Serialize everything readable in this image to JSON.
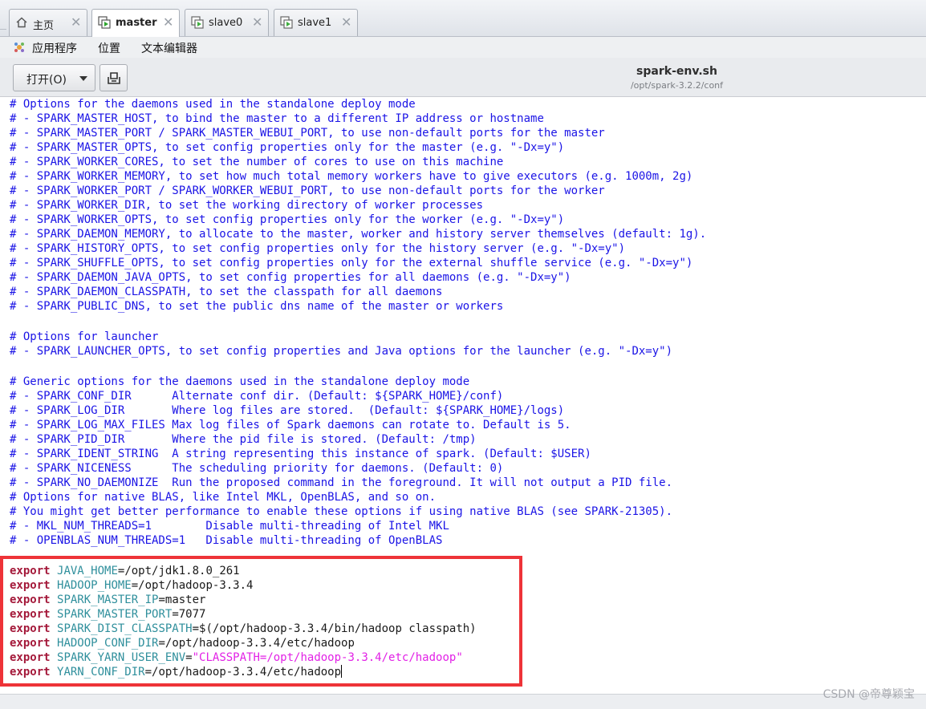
{
  "tabs": [
    {
      "label": "主页",
      "icon": "home-icon",
      "active": false
    },
    {
      "label": "master",
      "icon": "vm-icon",
      "active": true
    },
    {
      "label": "slave0",
      "icon": "vm-icon",
      "active": false
    },
    {
      "label": "slave1",
      "icon": "vm-icon",
      "active": false
    }
  ],
  "menu": {
    "apps": "应用程序",
    "places": "位置",
    "editor": "文本编辑器"
  },
  "toolbar": {
    "open_label": "打开(O)"
  },
  "document": {
    "title": "spark-env.sh",
    "path": "/opt/spark-3.2.2/conf"
  },
  "code": {
    "comments_block1": [
      "# Options for the daemons used in the standalone deploy mode",
      "# - SPARK_MASTER_HOST, to bind the master to a different IP address or hostname",
      "# - SPARK_MASTER_PORT / SPARK_MASTER_WEBUI_PORT, to use non-default ports for the master",
      "# - SPARK_MASTER_OPTS, to set config properties only for the master (e.g. \"-Dx=y\")",
      "# - SPARK_WORKER_CORES, to set the number of cores to use on this machine",
      "# - SPARK_WORKER_MEMORY, to set how much total memory workers have to give executors (e.g. 1000m, 2g)",
      "# - SPARK_WORKER_PORT / SPARK_WORKER_WEBUI_PORT, to use non-default ports for the worker",
      "# - SPARK_WORKER_DIR, to set the working directory of worker processes",
      "# - SPARK_WORKER_OPTS, to set config properties only for the worker (e.g. \"-Dx=y\")",
      "# - SPARK_DAEMON_MEMORY, to allocate to the master, worker and history server themselves (default: 1g).",
      "# - SPARK_HISTORY_OPTS, to set config properties only for the history server (e.g. \"-Dx=y\")",
      "# - SPARK_SHUFFLE_OPTS, to set config properties only for the external shuffle service (e.g. \"-Dx=y\")",
      "# - SPARK_DAEMON_JAVA_OPTS, to set config properties for all daemons (e.g. \"-Dx=y\")",
      "# - SPARK_DAEMON_CLASSPATH, to set the classpath for all daemons",
      "# - SPARK_PUBLIC_DNS, to set the public dns name of the master or workers"
    ],
    "comments_block2": [
      "# Options for launcher",
      "# - SPARK_LAUNCHER_OPTS, to set config properties and Java options for the launcher (e.g. \"-Dx=y\")"
    ],
    "comments_block3": [
      "# Generic options for the daemons used in the standalone deploy mode",
      "# - SPARK_CONF_DIR      Alternate conf dir. (Default: ${SPARK_HOME}/conf)",
      "# - SPARK_LOG_DIR       Where log files are stored.  (Default: ${SPARK_HOME}/logs)",
      "# - SPARK_LOG_MAX_FILES Max log files of Spark daemons can rotate to. Default is 5.",
      "# - SPARK_PID_DIR       Where the pid file is stored. (Default: /tmp)",
      "# - SPARK_IDENT_STRING  A string representing this instance of spark. (Default: $USER)",
      "# - SPARK_NICENESS      The scheduling priority for daemons. (Default: 0)",
      "# - SPARK_NO_DAEMONIZE  Run the proposed command in the foreground. It will not output a PID file.",
      "# Options for native BLAS, like Intel MKL, OpenBLAS, and so on.",
      "# You might get better performance to enable these options if using native BLAS (see SPARK-21305).",
      "# - MKL_NUM_THREADS=1        Disable multi-threading of Intel MKL",
      "# - OPENBLAS_NUM_THREADS=1   Disable multi-threading of OpenBLAS"
    ],
    "exports": [
      {
        "keyword": "export",
        "name": "JAVA_HOME",
        "value": "/opt/jdk1.8.0_261",
        "quoted": false
      },
      {
        "keyword": "export",
        "name": "HADOOP_HOME",
        "value": "/opt/hadoop-3.3.4",
        "quoted": false
      },
      {
        "keyword": "export",
        "name": "SPARK_MASTER_IP",
        "value": "master",
        "quoted": false
      },
      {
        "keyword": "export",
        "name": "SPARK_MASTER_PORT",
        "value": "7077",
        "quoted": false
      },
      {
        "keyword": "export",
        "name": "SPARK_DIST_CLASSPATH",
        "value": "$(/opt/hadoop-3.3.4/bin/hadoop classpath)",
        "quoted": false
      },
      {
        "keyword": "export",
        "name": "HADOOP_CONF_DIR",
        "value": "/opt/hadoop-3.3.4/etc/hadoop",
        "quoted": false
      },
      {
        "keyword": "export",
        "name": "SPARK_YARN_USER_ENV",
        "value": "\"CLASSPATH=/opt/hadoop-3.3.4/etc/hadoop\"",
        "quoted": true
      },
      {
        "keyword": "export",
        "name": "YARN_CONF_DIR",
        "value": "/opt/hadoop-3.3.4/etc/hadoop",
        "quoted": false
      }
    ]
  },
  "watermark": "CSDN @帝尊颖宝",
  "colors": {
    "comment": "#1b14e6",
    "keyword": "#a4193a",
    "variable": "#2f8f9c",
    "string": "#e222e6",
    "highlight_border": "#ee3338"
  }
}
